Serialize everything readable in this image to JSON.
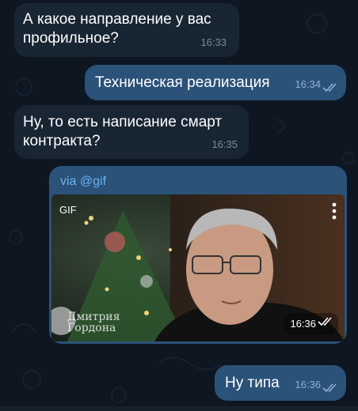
{
  "messages": [
    {
      "text_line1": "А какое направление у вас",
      "text_line2": "профильное?",
      "time": "16:33"
    },
    {
      "text": "Техническая реализация",
      "time": "16:34"
    },
    {
      "text_line1": "Ну, то есть написание смарт",
      "text_line2": "контракта?",
      "time": "16:35"
    },
    {
      "via_prefix": "via ",
      "via_bot": "@gif",
      "gif_label": "GIF",
      "time": "16:36",
      "watermark_line1": "Дмитрия",
      "watermark_line2": "Гордона"
    },
    {
      "text": "Ну типа",
      "time": "16:36"
    }
  ],
  "colors": {
    "incoming": "#182533",
    "outgoing": "#2b5278",
    "link": "#6ab3f3",
    "read_check": "#8fb1d3"
  },
  "icons": {
    "read": "double-check-icon",
    "menu": "more-vertical-icon"
  }
}
